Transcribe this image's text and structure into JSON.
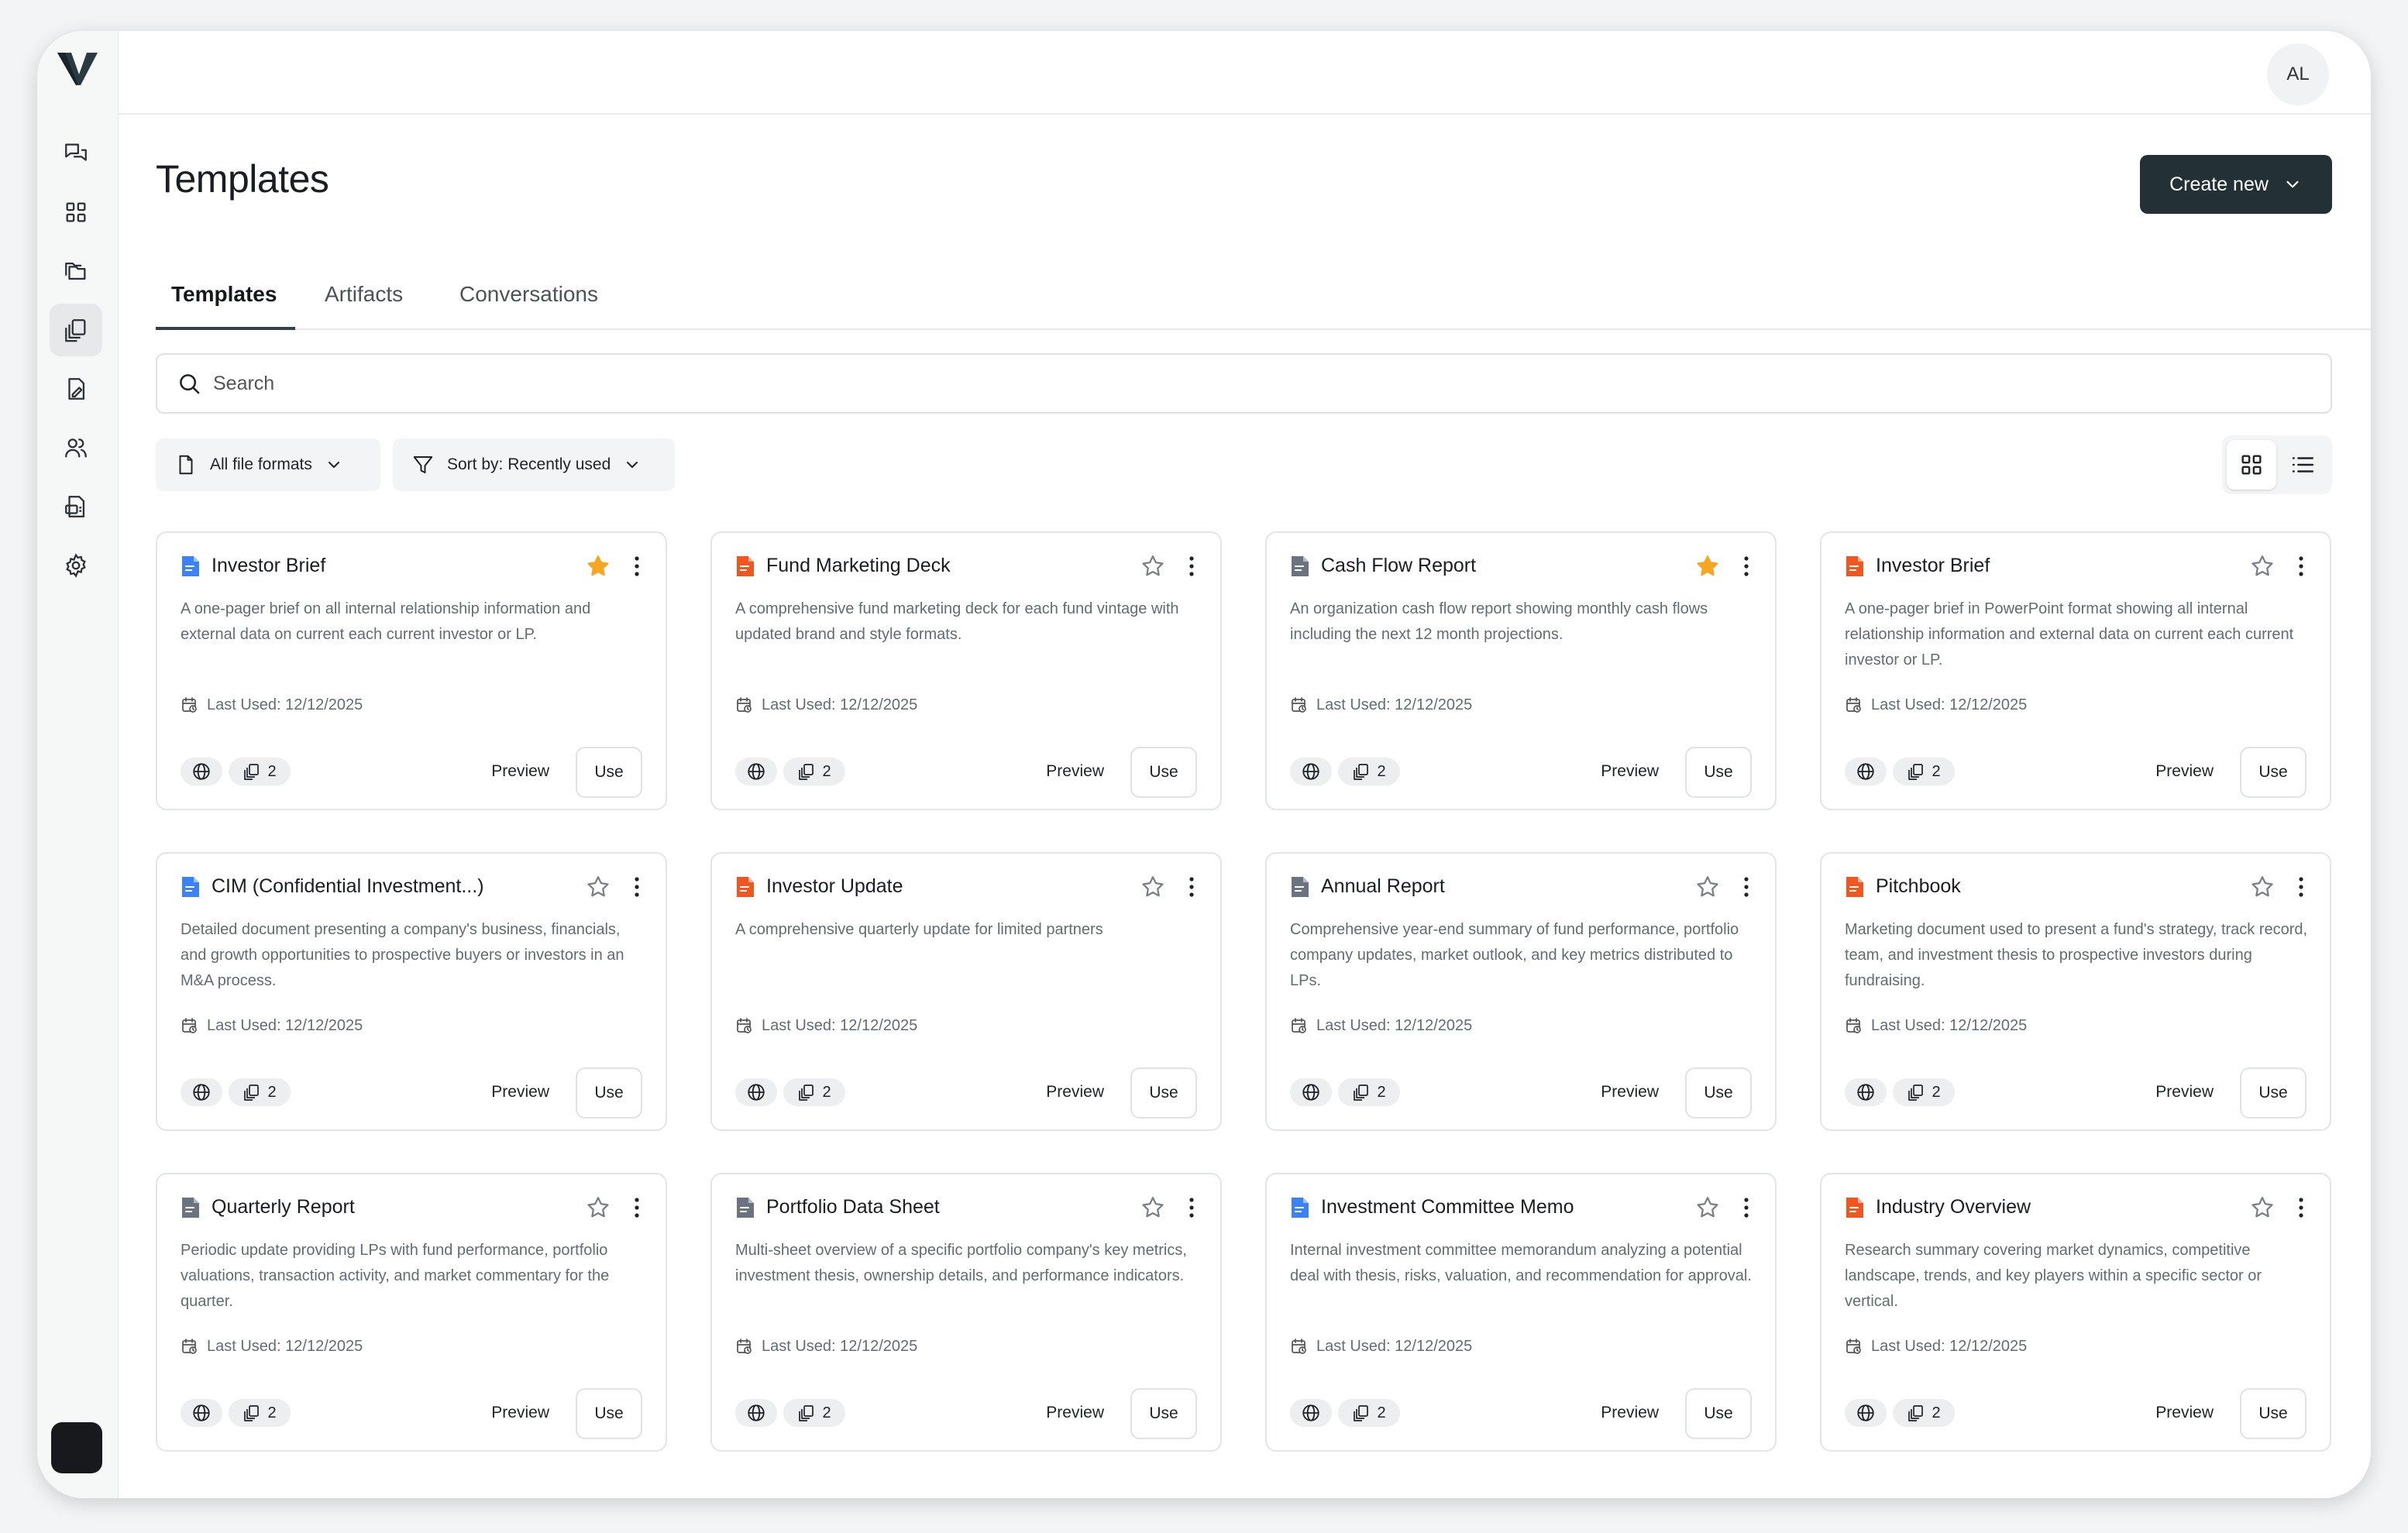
{
  "user": {
    "initials": "AL"
  },
  "header": {
    "title": "Templates",
    "create_label": "Create new"
  },
  "tabs": [
    {
      "label": "Templates",
      "active": true
    },
    {
      "label": "Artifacts",
      "active": false
    },
    {
      "label": "Conversations",
      "active": false
    }
  ],
  "search": {
    "placeholder": "Search"
  },
  "filters": {
    "formats_label": "All file formats",
    "sort_label": "Sort by: Recently used"
  },
  "sidebar": {
    "items": [
      {
        "icon": "chat-icon",
        "active": false
      },
      {
        "icon": "dashboard-icon",
        "active": false
      },
      {
        "icon": "folders-icon",
        "active": false
      },
      {
        "icon": "templates-icon",
        "active": true
      },
      {
        "icon": "file-edit-icon",
        "active": false
      },
      {
        "icon": "users-icon",
        "active": false
      },
      {
        "icon": "report-icon",
        "active": false
      },
      {
        "icon": "settings-icon",
        "active": false
      }
    ]
  },
  "colors": {
    "word": "#3b82f6",
    "ppt": "#f0561f",
    "sheet": "#6b7280",
    "star": "#f5a623",
    "primary": "#233035"
  },
  "labels": {
    "preview": "Preview",
    "use": "Use"
  },
  "cards": [
    {
      "name": "Investor Brief",
      "type": "word",
      "starred": true,
      "description": "A one-pager brief on all internal relationship information and external data on current each current investor or LP.",
      "last_used": "Last Used: 12/12/2025",
      "count": "2"
    },
    {
      "name": "Fund Marketing Deck",
      "type": "ppt",
      "starred": false,
      "description": "A comprehensive fund marketing deck for each fund vintage with updated brand and style formats.",
      "last_used": "Last Used: 12/12/2025",
      "count": "2"
    },
    {
      "name": "Cash Flow Report",
      "type": "sheet",
      "starred": true,
      "description": "An organization cash flow report showing monthly cash flows including the next 12 month projections.",
      "last_used": "Last Used: 12/12/2025",
      "count": "2"
    },
    {
      "name": "Investor Brief",
      "type": "ppt",
      "starred": false,
      "description": "A one-pager brief in PowerPoint format showing all internal relationship information and external data on current each current investor or LP.",
      "last_used": "Last Used: 12/12/2025",
      "count": "2"
    },
    {
      "name": "CIM (Confidential Investment...)",
      "type": "word",
      "starred": false,
      "description": "Detailed document presenting a company's business, financials, and growth opportunities to prospective buyers or investors in an M&A process.",
      "last_used": "Last Used: 12/12/2025",
      "count": "2"
    },
    {
      "name": "Investor Update",
      "type": "ppt",
      "starred": false,
      "description": "A comprehensive quarterly update for limited partners",
      "last_used": "Last Used: 12/12/2025",
      "count": "2"
    },
    {
      "name": "Annual Report",
      "type": "sheet",
      "starred": false,
      "description": "Comprehensive year-end summary of fund performance, portfolio company updates, market outlook, and key metrics distributed to LPs.",
      "last_used": "Last Used: 12/12/2025",
      "count": "2"
    },
    {
      "name": "Pitchbook",
      "type": "ppt",
      "starred": false,
      "description": "Marketing document used to present a fund's strategy, track record, team, and investment thesis to prospective investors during fundraising.",
      "last_used": "Last Used: 12/12/2025",
      "count": "2"
    },
    {
      "name": "Quarterly Report",
      "type": "sheet",
      "starred": false,
      "description": "Periodic update providing LPs with fund performance, portfolio valuations, transaction activity, and market commentary for the quarter.",
      "last_used": "Last Used: 12/12/2025",
      "count": "2"
    },
    {
      "name": "Portfolio Data Sheet",
      "type": "sheet",
      "starred": false,
      "description": "Multi-sheet overview of a specific portfolio company's key metrics, investment thesis, ownership details, and performance indicators.",
      "last_used": "Last Used: 12/12/2025",
      "count": "2"
    },
    {
      "name": "Investment Committee Memo",
      "type": "word",
      "starred": false,
      "description": "Internal investment committee memorandum analyzing a potential deal with thesis, risks, valuation, and recommendation for approval.",
      "last_used": "Last Used: 12/12/2025",
      "count": "2"
    },
    {
      "name": "Industry Overview",
      "type": "ppt",
      "starred": false,
      "description": "Research summary covering market dynamics, competitive landscape, trends, and key players within a specific sector or vertical.",
      "last_used": "Last Used: 12/12/2025",
      "count": "2"
    }
  ]
}
